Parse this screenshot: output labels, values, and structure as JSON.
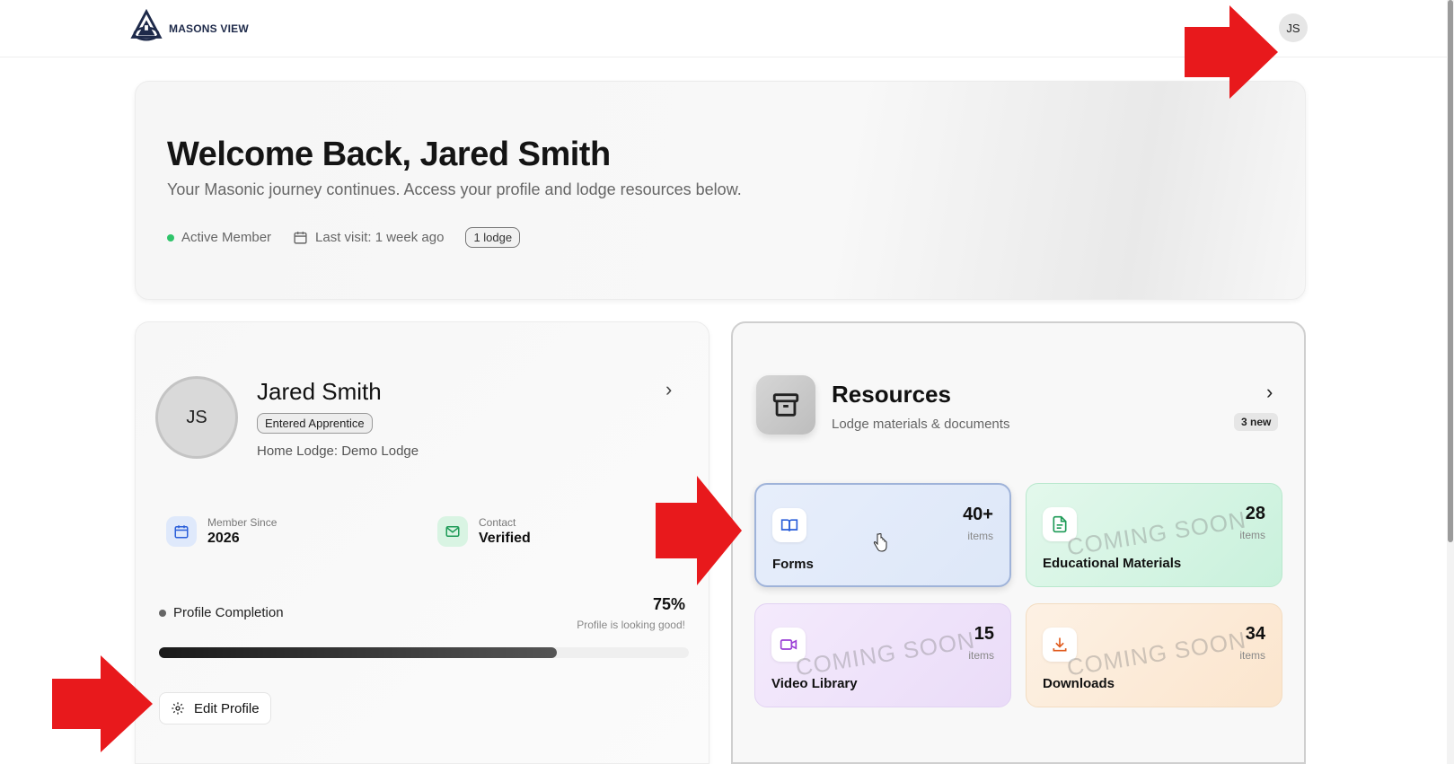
{
  "brand": {
    "name": "MASONS VIEW"
  },
  "header": {
    "avatar_initials": "JS"
  },
  "welcome": {
    "title": "Welcome Back, Jared Smith",
    "subtitle": "Your Masonic journey continues. Access your profile and lodge resources below.",
    "status": "Active Member",
    "last_visit": "Last visit: 1 week ago",
    "lodge_count": "1 lodge"
  },
  "profile": {
    "initials": "JS",
    "name": "Jared Smith",
    "rank": "Entered Apprentice",
    "home_lodge": "Home Lodge: Demo Lodge",
    "member_since_label": "Member Since",
    "member_since_value": "2026",
    "contact_label": "Contact",
    "contact_value": "Verified",
    "completion_label": "Profile Completion",
    "completion_pct": "75%",
    "completion_value": 0.75,
    "completion_msg": "Profile is looking good!",
    "edit_label": "Edit Profile"
  },
  "resources": {
    "title": "Resources",
    "subtitle": "Lodge materials & documents",
    "new_badge": "3 new",
    "coming_soon": "COMING SOON",
    "tiles": [
      {
        "label": "Forms",
        "count": "40+",
        "unit": "items",
        "icon": "book-open-icon",
        "color": "#2b5fd9"
      },
      {
        "label": "Educational Materials",
        "count": "28",
        "unit": "items",
        "icon": "document-icon",
        "color": "#1e9b57"
      },
      {
        "label": "Video Library",
        "count": "15",
        "unit": "items",
        "icon": "video-icon",
        "color": "#9b3fd6"
      },
      {
        "label": "Downloads",
        "count": "34",
        "unit": "items",
        "icon": "download-icon",
        "color": "#e05a1c"
      }
    ]
  },
  "colors": {
    "annotation_red": "#e8191c",
    "active_green": "#2fc46a"
  }
}
